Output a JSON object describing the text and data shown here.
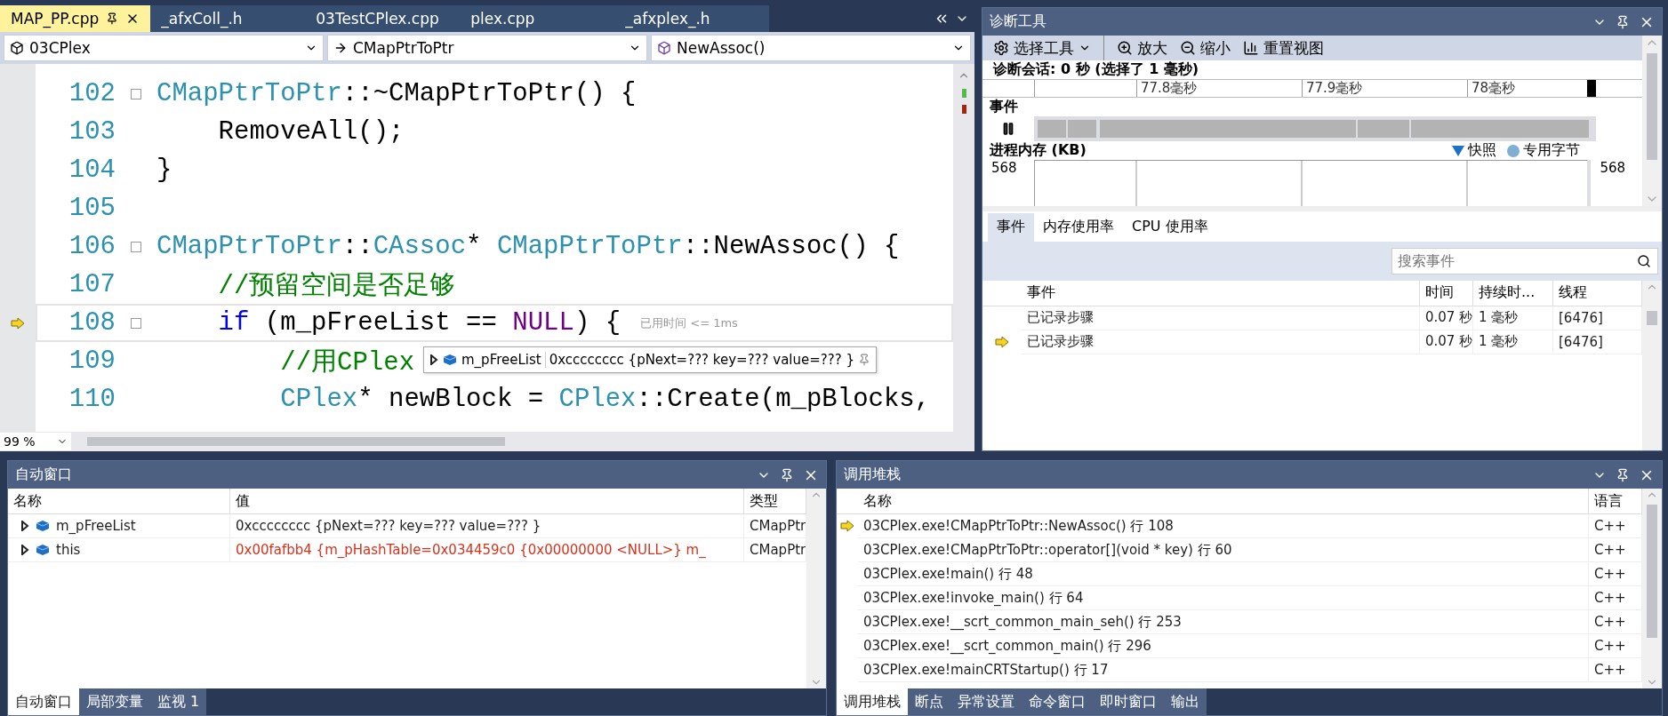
{
  "editor": {
    "tabs": [
      {
        "label": "MAP_PP.cpp",
        "selected": true
      },
      {
        "label": "_afxColl_.h",
        "selected": false
      },
      {
        "label": "03TestCPlex.cpp",
        "selected": false
      },
      {
        "label": "plex.cpp",
        "selected": false
      },
      {
        "label": "_afxplex_.h",
        "selected": false
      }
    ],
    "nav": {
      "project": "03CPlex",
      "class": "CMapPtrToPtr",
      "member": "NewAssoc()"
    },
    "lines": [
      {
        "number": "102",
        "fold": true,
        "current": false,
        "tokens": [
          {
            "kind": "type",
            "text": "CMapPtrToPtr"
          },
          {
            "kind": "plain",
            "text": "::~CMapPtrToPtr() {"
          }
        ]
      },
      {
        "number": "103",
        "fold": false,
        "current": false,
        "tokens": [
          {
            "kind": "plain",
            "text": "    RemoveAll();"
          }
        ]
      },
      {
        "number": "104",
        "fold": false,
        "current": false,
        "tokens": [
          {
            "kind": "plain",
            "text": "}"
          }
        ]
      },
      {
        "number": "105",
        "fold": false,
        "current": false
      },
      {
        "number": "106",
        "fold": true,
        "current": false,
        "tokens": [
          {
            "kind": "type",
            "text": "CMapPtrToPtr"
          },
          {
            "kind": "plain",
            "text": "::"
          },
          {
            "kind": "type",
            "text": "CAssoc"
          },
          {
            "kind": "plain",
            "text": "* "
          },
          {
            "kind": "type",
            "text": "CMapPtrToPtr"
          },
          {
            "kind": "plain",
            "text": "::NewAssoc() {"
          }
        ]
      },
      {
        "number": "107",
        "fold": false,
        "current": false,
        "tokens": [
          {
            "kind": "comment",
            "text": "    //预留空间是否足够"
          }
        ]
      },
      {
        "number": "108",
        "fold": true,
        "current": true,
        "tokens": [
          {
            "kind": "keyword",
            "text": "    if"
          },
          {
            "kind": "plain",
            "text": " (m_pFreeList == "
          },
          {
            "kind": "macro",
            "text": "NULL"
          },
          {
            "kind": "plain",
            "text": ") {"
          }
        ],
        "hint": "已用时间 <= 1ms"
      },
      {
        "number": "109",
        "fold": false,
        "current": false,
        "tokens": [
          {
            "kind": "comment",
            "text": "        //用CPlex"
          }
        ]
      },
      {
        "number": "110",
        "fold": false,
        "current": false,
        "tokens": [
          {
            "kind": "type",
            "text": "        CPlex"
          },
          {
            "kind": "plain",
            "text": "* newBlock = "
          },
          {
            "kind": "type",
            "text": "CPlex"
          },
          {
            "kind": "plain",
            "text": "::Create(m_pBlocks,"
          }
        ]
      }
    ],
    "datatip": {
      "name": "m_pFreeList",
      "value": "0xcccccccc {pNext=??? key=??? value=??? }"
    },
    "zoom": "99 %"
  },
  "diagnostics": {
    "title": "诊断工具",
    "toolbar": [
      {
        "kind": "menu",
        "label": "选择工具"
      },
      {
        "kind": "zoom-in",
        "label": "放大"
      },
      {
        "kind": "zoom-out",
        "label": "缩小"
      },
      {
        "kind": "reset",
        "label": "重置视图"
      }
    ],
    "session": "诊断会话: 0 秒 (选择了 1 毫秒)",
    "ruler_labels": [
      "77.8毫秒",
      "77.9毫秒",
      "78毫秒"
    ],
    "events_label": "事件",
    "memory_label": "进程内存 (KB)",
    "legend": [
      {
        "kind": "triangle",
        "label": "快照",
        "color": "#1e6fc9"
      },
      {
        "kind": "dot",
        "label": "专用字节",
        "color": "#7fb0d4"
      }
    ],
    "memory_axis": [
      "568",
      "568"
    ],
    "tabs": [
      {
        "label": "事件",
        "selected": true
      },
      {
        "label": "内存使用率",
        "selected": false
      },
      {
        "label": "CPU 使用率",
        "selected": false
      }
    ],
    "search": {
      "placeholder": "搜索事件"
    },
    "columns": [
      "事件",
      "时间",
      "持续时...",
      "线程"
    ],
    "rows": [
      {
        "event": "已记录步骤",
        "time": "0.07 秒",
        "duration": "1 毫秒",
        "thread": "[6476]",
        "current": false
      },
      {
        "event": "已记录步骤",
        "time": "0.07 秒",
        "duration": "1 毫秒",
        "thread": "[6476]",
        "current": true
      }
    ]
  },
  "autos": {
    "title": "自动窗口",
    "columns": [
      "名称",
      "值",
      "类型"
    ],
    "rows": [
      {
        "name": "m_pFreeList",
        "value": "0xcccccccc {pNext=??? key=??? value=??? }",
        "type": "CMapPtr",
        "changed": false
      },
      {
        "name": "this",
        "value": "0x00fafbb4 {m_pHashTable=0x034459c0 {0x00000000 <NULL>} m_",
        "type": "CMapPtr",
        "changed": true
      }
    ],
    "tabs": [
      {
        "label": "自动窗口",
        "selected": true
      },
      {
        "label": "局部变量",
        "selected": false
      },
      {
        "label": "监视 1",
        "selected": false
      }
    ]
  },
  "call_stack": {
    "title": "调用堆栈",
    "columns": [
      "名称",
      "语言"
    ],
    "rows": [
      {
        "name": "03CPlex.exe!CMapPtrToPtr::NewAssoc() 行 108",
        "language": "C++",
        "current": true
      },
      {
        "name": "03CPlex.exe!CMapPtrToPtr::operator[](void * key) 行 60",
        "language": "C++",
        "current": false
      },
      {
        "name": "03CPlex.exe!main() 行 48",
        "language": "C++",
        "current": false
      },
      {
        "name": "03CPlex.exe!invoke_main() 行 64",
        "language": "C++",
        "current": false
      },
      {
        "name": "03CPlex.exe!__scrt_common_main_seh() 行 253",
        "language": "C++",
        "current": false
      },
      {
        "name": "03CPlex.exe!__scrt_common_main() 行 296",
        "language": "C++",
        "current": false
      },
      {
        "name": "03CPlex.exe!mainCRTStartup() 行 17",
        "language": "C++",
        "current": false
      }
    ],
    "tabs": [
      {
        "label": "调用堆栈",
        "selected": true
      },
      {
        "label": "断点",
        "selected": false
      },
      {
        "label": "异常设置",
        "selected": false
      },
      {
        "label": "命令窗口",
        "selected": false
      },
      {
        "label": "即时窗口",
        "selected": false
      },
      {
        "label": "输出",
        "selected": false
      }
    ]
  }
}
